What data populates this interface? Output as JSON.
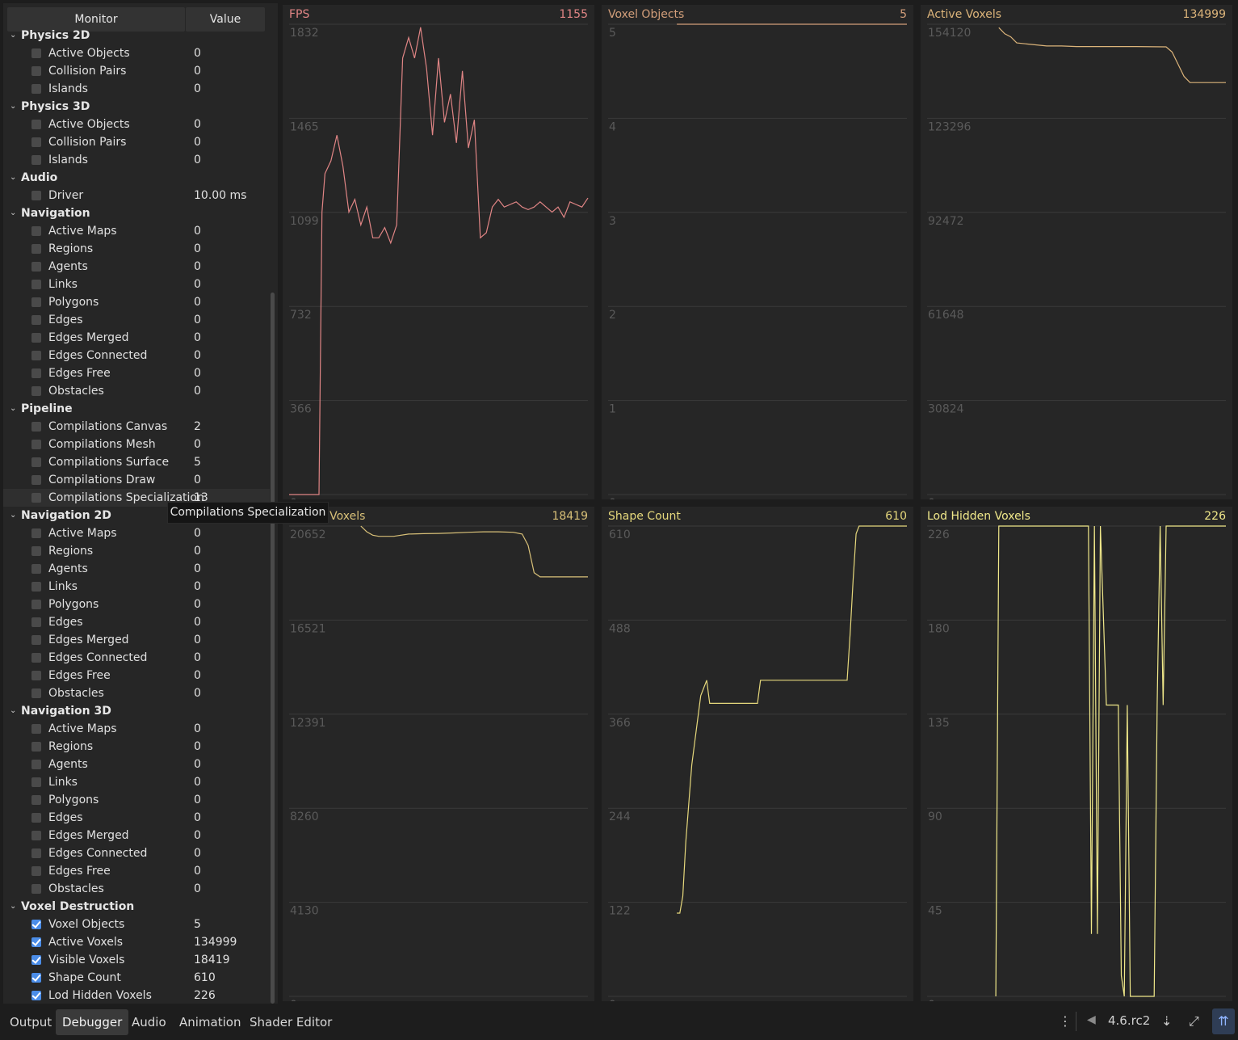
{
  "header": {
    "monitor_label": "Monitor",
    "value_label": "Value"
  },
  "tree": [
    {
      "type": "group",
      "label": "Physics 2D"
    },
    {
      "type": "item",
      "label": "Active Objects",
      "value": "0",
      "checked": false
    },
    {
      "type": "item",
      "label": "Collision Pairs",
      "value": "0",
      "checked": false
    },
    {
      "type": "item",
      "label": "Islands",
      "value": "0",
      "checked": false
    },
    {
      "type": "group",
      "label": "Physics 3D"
    },
    {
      "type": "item",
      "label": "Active Objects",
      "value": "0",
      "checked": false
    },
    {
      "type": "item",
      "label": "Collision Pairs",
      "value": "0",
      "checked": false
    },
    {
      "type": "item",
      "label": "Islands",
      "value": "0",
      "checked": false
    },
    {
      "type": "group",
      "label": "Audio"
    },
    {
      "type": "item",
      "label": "Driver",
      "value": "10.00 ms",
      "checked": false
    },
    {
      "type": "group",
      "label": "Navigation"
    },
    {
      "type": "item",
      "label": "Active Maps",
      "value": "0",
      "checked": false
    },
    {
      "type": "item",
      "label": "Regions",
      "value": "0",
      "checked": false
    },
    {
      "type": "item",
      "label": "Agents",
      "value": "0",
      "checked": false
    },
    {
      "type": "item",
      "label": "Links",
      "value": "0",
      "checked": false
    },
    {
      "type": "item",
      "label": "Polygons",
      "value": "0",
      "checked": false
    },
    {
      "type": "item",
      "label": "Edges",
      "value": "0",
      "checked": false
    },
    {
      "type": "item",
      "label": "Edges Merged",
      "value": "0",
      "checked": false
    },
    {
      "type": "item",
      "label": "Edges Connected",
      "value": "0",
      "checked": false
    },
    {
      "type": "item",
      "label": "Edges Free",
      "value": "0",
      "checked": false
    },
    {
      "type": "item",
      "label": "Obstacles",
      "value": "0",
      "checked": false
    },
    {
      "type": "group",
      "label": "Pipeline"
    },
    {
      "type": "item",
      "label": "Compilations Canvas",
      "value": "2",
      "checked": false
    },
    {
      "type": "item",
      "label": "Compilations Mesh",
      "value": "0",
      "checked": false
    },
    {
      "type": "item",
      "label": "Compilations Surface",
      "value": "5",
      "checked": false
    },
    {
      "type": "item",
      "label": "Compilations Draw",
      "value": "0",
      "checked": false
    },
    {
      "type": "item",
      "label": "Compilations Specialization",
      "value": "13",
      "checked": false,
      "hovered": true
    },
    {
      "type": "group",
      "label": "Navigation 2D"
    },
    {
      "type": "item",
      "label": "Active Maps",
      "value": "0",
      "checked": false
    },
    {
      "type": "item",
      "label": "Regions",
      "value": "0",
      "checked": false
    },
    {
      "type": "item",
      "label": "Agents",
      "value": "0",
      "checked": false
    },
    {
      "type": "item",
      "label": "Links",
      "value": "0",
      "checked": false
    },
    {
      "type": "item",
      "label": "Polygons",
      "value": "0",
      "checked": false
    },
    {
      "type": "item",
      "label": "Edges",
      "value": "0",
      "checked": false
    },
    {
      "type": "item",
      "label": "Edges Merged",
      "value": "0",
      "checked": false
    },
    {
      "type": "item",
      "label": "Edges Connected",
      "value": "0",
      "checked": false
    },
    {
      "type": "item",
      "label": "Edges Free",
      "value": "0",
      "checked": false
    },
    {
      "type": "item",
      "label": "Obstacles",
      "value": "0",
      "checked": false
    },
    {
      "type": "group",
      "label": "Navigation 3D"
    },
    {
      "type": "item",
      "label": "Active Maps",
      "value": "0",
      "checked": false
    },
    {
      "type": "item",
      "label": "Regions",
      "value": "0",
      "checked": false
    },
    {
      "type": "item",
      "label": "Agents",
      "value": "0",
      "checked": false
    },
    {
      "type": "item",
      "label": "Links",
      "value": "0",
      "checked": false
    },
    {
      "type": "item",
      "label": "Polygons",
      "value": "0",
      "checked": false
    },
    {
      "type": "item",
      "label": "Edges",
      "value": "0",
      "checked": false
    },
    {
      "type": "item",
      "label": "Edges Merged",
      "value": "0",
      "checked": false
    },
    {
      "type": "item",
      "label": "Edges Connected",
      "value": "0",
      "checked": false
    },
    {
      "type": "item",
      "label": "Edges Free",
      "value": "0",
      "checked": false
    },
    {
      "type": "item",
      "label": "Obstacles",
      "value": "0",
      "checked": false
    },
    {
      "type": "group",
      "label": "Voxel Destruction"
    },
    {
      "type": "item",
      "label": "Voxel Objects",
      "value": "5",
      "checked": true
    },
    {
      "type": "item",
      "label": "Active Voxels",
      "value": "134999",
      "checked": true
    },
    {
      "type": "item",
      "label": "Visible Voxels",
      "value": "18419",
      "checked": true
    },
    {
      "type": "item",
      "label": "Shape Count",
      "value": "610",
      "checked": true
    },
    {
      "type": "item",
      "label": "Lod Hidden Voxels",
      "value": "226",
      "checked": true
    }
  ],
  "tooltip": "Compilations Specialization",
  "colors": {
    "fps": "#e08585",
    "voxel_objects": "#d29e7a",
    "active_voxels": "#dcb47a",
    "visible_voxels": "#d8c078",
    "shape_count": "#e6d87c",
    "lod_hidden": "#f0e88a",
    "grid": "#3a3a3a",
    "axis_text": "#5a5a5a"
  },
  "chart_data": [
    {
      "type": "line",
      "title": "FPS",
      "current": "1155",
      "ylim": [
        0,
        1832
      ],
      "ticks": [
        "1832",
        "1465",
        "1099",
        "732",
        "366",
        "0"
      ],
      "color_key": "fps",
      "x": [
        0,
        2,
        4,
        6,
        8,
        10,
        11,
        12,
        14,
        16,
        18,
        20,
        22,
        24,
        26,
        28,
        30,
        32,
        34,
        36,
        38,
        40,
        42,
        44,
        46,
        48,
        50,
        52,
        54,
        56,
        58,
        60,
        62,
        64,
        66,
        68,
        70,
        72,
        74,
        76,
        78,
        80,
        82,
        84,
        86,
        88,
        90,
        92,
        94,
        96,
        98,
        100
      ],
      "values": [
        0,
        0,
        0,
        0,
        0,
        0,
        1100,
        1250,
        1300,
        1400,
        1280,
        1100,
        1150,
        1050,
        1120,
        1000,
        1000,
        1040,
        980,
        1050,
        1700,
        1780,
        1700,
        1820,
        1660,
        1400,
        1700,
        1450,
        1560,
        1370,
        1650,
        1350,
        1460,
        1000,
        1020,
        1120,
        1150,
        1120,
        1130,
        1140,
        1120,
        1110,
        1120,
        1140,
        1120,
        1100,
        1120,
        1080,
        1140,
        1130,
        1120,
        1155
      ]
    },
    {
      "type": "line",
      "title": "Voxel Objects",
      "current": "5",
      "ylim": [
        0,
        5
      ],
      "ticks": [
        "5",
        "4",
        "3",
        "2",
        "1",
        "0"
      ],
      "color_key": "voxel_objects",
      "x": [
        0,
        22,
        23,
        100
      ],
      "values": [
        null,
        null,
        5,
        5
      ]
    },
    {
      "type": "line",
      "title": "Active Voxels",
      "current": "134999",
      "ylim": [
        0,
        154120
      ],
      "ticks": [
        "154120",
        "123296",
        "92472",
        "61648",
        "30824",
        "0"
      ],
      "color_key": "active_voxels",
      "x": [
        0,
        22,
        24,
        26,
        28,
        30,
        35,
        40,
        45,
        50,
        60,
        70,
        80,
        82,
        84,
        86,
        88,
        90,
        100
      ],
      "values": [
        null,
        null,
        153000,
        151000,
        150000,
        148000,
        147500,
        147000,
        147000,
        146800,
        146800,
        146800,
        146700,
        145000,
        141000,
        137000,
        135000,
        134999,
        134999
      ]
    },
    {
      "type": "line",
      "title": "Visible Voxels",
      "current": "18419",
      "ylim": [
        0,
        20652
      ],
      "ticks": [
        "20652",
        "16521",
        "12391",
        "8260",
        "4130",
        "0"
      ],
      "color_key": "visible_voxels",
      "x": [
        0,
        22,
        24,
        26,
        28,
        30,
        35,
        40,
        45,
        50,
        55,
        60,
        65,
        70,
        75,
        78,
        80,
        82,
        84,
        86,
        100
      ],
      "values": [
        null,
        null,
        20652,
        20400,
        20250,
        20200,
        20200,
        20300,
        20320,
        20330,
        20350,
        20380,
        20400,
        20400,
        20380,
        20300,
        19800,
        18600,
        18419,
        18419,
        18419
      ]
    },
    {
      "type": "line",
      "title": "Shape Count",
      "current": "610",
      "ylim": [
        0,
        610
      ],
      "ticks": [
        "610",
        "488",
        "366",
        "244",
        "122",
        "0"
      ],
      "color_key": "shape_count",
      "x": [
        0,
        22,
        23,
        24,
        25,
        26,
        27,
        28,
        29,
        30,
        31,
        32,
        33,
        34,
        40,
        45,
        50,
        51,
        55,
        60,
        65,
        70,
        75,
        80,
        81,
        82,
        83,
        84,
        85,
        100
      ],
      "values": [
        null,
        null,
        108,
        108,
        130,
        200,
        250,
        300,
        330,
        360,
        390,
        400,
        410,
        380,
        380,
        380,
        380,
        410,
        410,
        410,
        410,
        410,
        410,
        410,
        470,
        540,
        600,
        610,
        610,
        610
      ]
    },
    {
      "type": "line",
      "title": "Lod Hidden Voxels",
      "current": "226",
      "ylim": [
        0,
        226
      ],
      "ticks": [
        "226",
        "180",
        "135",
        "90",
        "45",
        "0"
      ],
      "color_key": "lod_hidden",
      "x": [
        0,
        22,
        23,
        24,
        54,
        55,
        56,
        57,
        58,
        60,
        61,
        62,
        63,
        64,
        65,
        66,
        67,
        68,
        72,
        76,
        77,
        78,
        79,
        80,
        81,
        100
      ],
      "values": [
        null,
        null,
        0,
        226,
        226,
        30,
        226,
        30,
        226,
        140,
        140,
        140,
        140,
        140,
        10,
        0,
        140,
        0,
        0,
        0,
        140,
        226,
        140,
        226,
        226,
        226
      ]
    }
  ],
  "bottom": {
    "tabs": [
      "Output",
      "Debugger",
      "Audio",
      "Animation",
      "Shader Editor"
    ],
    "active_tab": 1,
    "version": "4.6.rc2"
  }
}
